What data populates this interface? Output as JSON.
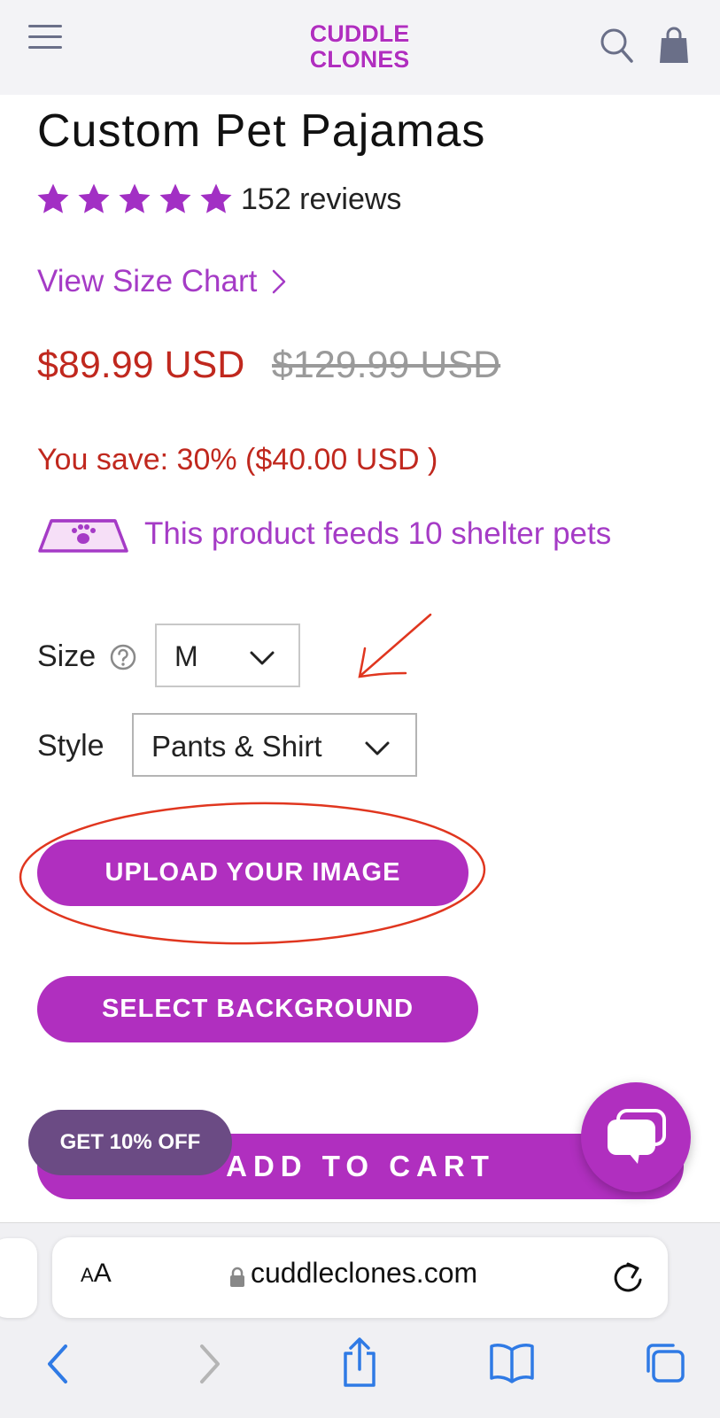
{
  "header": {
    "logo_line1": "CUDDLE",
    "logo_line2": "CLONES"
  },
  "product": {
    "title": "Custom Pet Pajamas",
    "rating_stars": 5,
    "reviews": "152 reviews",
    "size_chart_link": "View Size Chart",
    "price": "$89.99 USD",
    "compare_price": "$129.99 USD",
    "savings": "You save: 30% ($40.00 USD )",
    "feeds_text": "This product feeds 10 shelter pets"
  },
  "options": {
    "size_label": "Size",
    "size_value": "M",
    "style_label": "Style",
    "style_value": "Pants & Shirt"
  },
  "buttons": {
    "upload": "UPLOAD YOUR IMAGE",
    "background": "SELECT BACKGROUND",
    "add_to_cart": "ADD TO CART",
    "discount": "GET 10% OFF"
  },
  "browser": {
    "aa_small": "A",
    "aa_large": "A",
    "url": "cuddleclones.com"
  },
  "colors": {
    "brand_purple": "#b02fbf",
    "sale_red": "#c0281e",
    "link_purple": "#a53bc6",
    "annotation_red": "#e0361f",
    "star_purple": "#a22fc4"
  }
}
